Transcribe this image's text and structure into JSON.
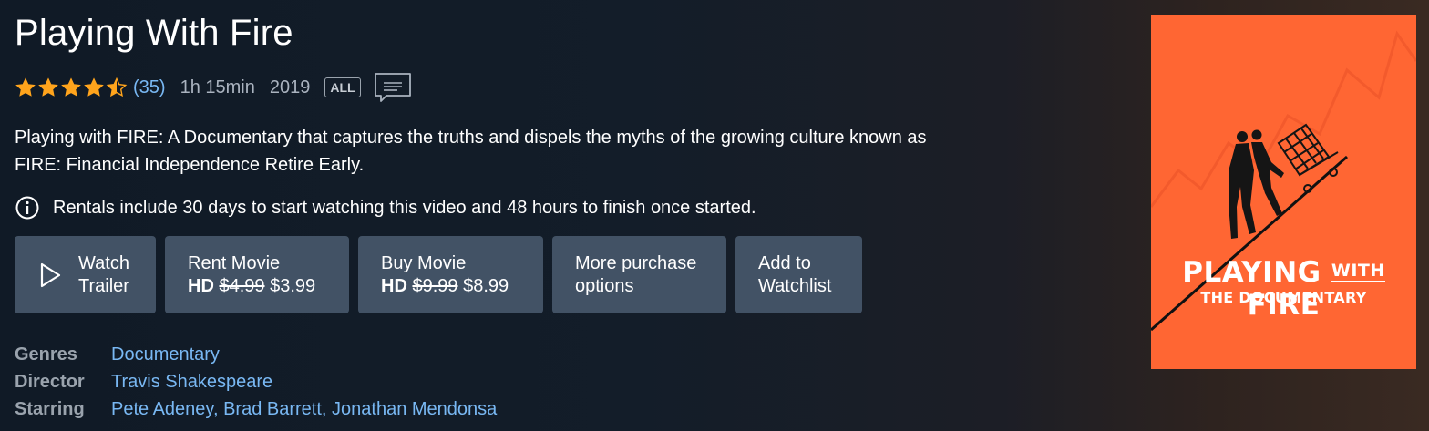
{
  "title": "Playing With Fire",
  "rating": {
    "stars": 4.5,
    "max_stars": 5,
    "count": "(35)"
  },
  "runtime": "1h 15min",
  "year": "2019",
  "maturity_rating": "ALL",
  "synopsis": "Playing with FIRE: A Documentary that captures the truths and dispels the myths of the growing culture known as FIRE: Financial Independence Retire Early.",
  "rental_note": "Rentals include 30 days to start watching this video and 48 hours to finish once started.",
  "actions": {
    "watch_trailer": {
      "line1": "Watch",
      "line2": "Trailer"
    },
    "rent": {
      "line1": "Rent Movie",
      "quality": "HD",
      "old_price": "$4.99",
      "price": "$3.99"
    },
    "buy": {
      "line1": "Buy Movie",
      "quality": "HD",
      "old_price": "$9.99",
      "price": "$8.99"
    },
    "more": {
      "line1": "More purchase",
      "line2": "options"
    },
    "watchlist": {
      "line1": "Add to",
      "line2": "Watchlist"
    }
  },
  "details": {
    "genres_label": "Genres",
    "genres": [
      "Documentary"
    ],
    "director_label": "Director",
    "director": "Travis Shakespeare",
    "starring_label": "Starring",
    "starring": [
      "Pete Adeney",
      "Brad Barrett",
      "Jonathan Mendonsa"
    ]
  },
  "poster": {
    "title_playing": "PLAYING",
    "title_with": "WITH",
    "title_fire": "FIRE",
    "subtitle": "THE DOCUMENTARY",
    "background": "#ff6633"
  },
  "colors": {
    "button_bg": "#425265",
    "link": "#79b8f3",
    "star": "#ffa41c"
  },
  "icons": [
    "star-icon",
    "closed-captions-icon",
    "info-icon",
    "play-icon"
  ]
}
